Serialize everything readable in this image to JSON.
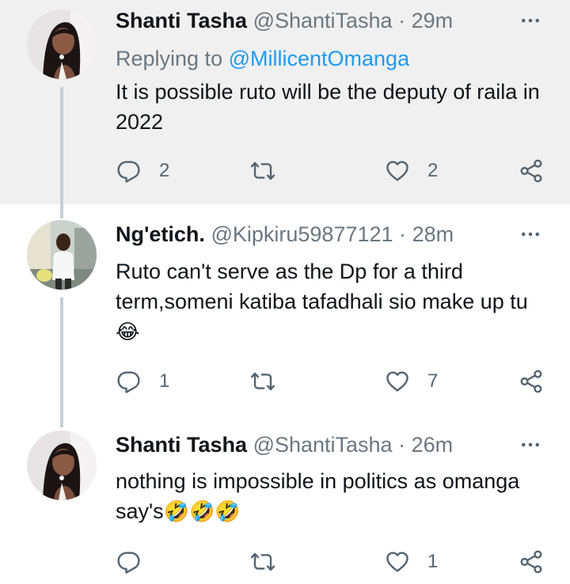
{
  "tweets": [
    {
      "name": "Shanti Tasha",
      "handle": "@ShantiTasha",
      "separator": "·",
      "time": "29m",
      "replying_prefix": "Replying to ",
      "replying_to": "@MillicentOmanga",
      "text": "It is possible ruto will be the deputy of raila in 2022",
      "emojis": "",
      "replies": "2",
      "retweets": "",
      "likes": "2",
      "highlighted": true
    },
    {
      "name": "Ng'etich.",
      "handle": "@Kipkiru59877121",
      "separator": "·",
      "time": "28m",
      "text": "Ruto can't serve as the Dp for a third term,someni katiba tafadhali sio make up tu",
      "emojis": "😂",
      "replies": "1",
      "retweets": "",
      "likes": "7",
      "highlighted": false
    },
    {
      "name": "Shanti Tasha",
      "handle": "@ShantiTasha",
      "separator": "·",
      "time": "26m",
      "text": "nothing is impossible in politics as omanga say's",
      "emojis": "🤣🤣🤣",
      "replies": "",
      "retweets": "",
      "likes": "1",
      "highlighted": false
    }
  ],
  "icons": {
    "more": "more-icon",
    "reply": "reply-icon",
    "retweet": "retweet-icon",
    "like": "like-icon",
    "share": "share-icon"
  },
  "colors": {
    "highlight_bg": "#f0f0f0",
    "mention": "#1d9bf0",
    "secondary_text": "#6b7780",
    "thread_line": "#c4cfd6"
  }
}
